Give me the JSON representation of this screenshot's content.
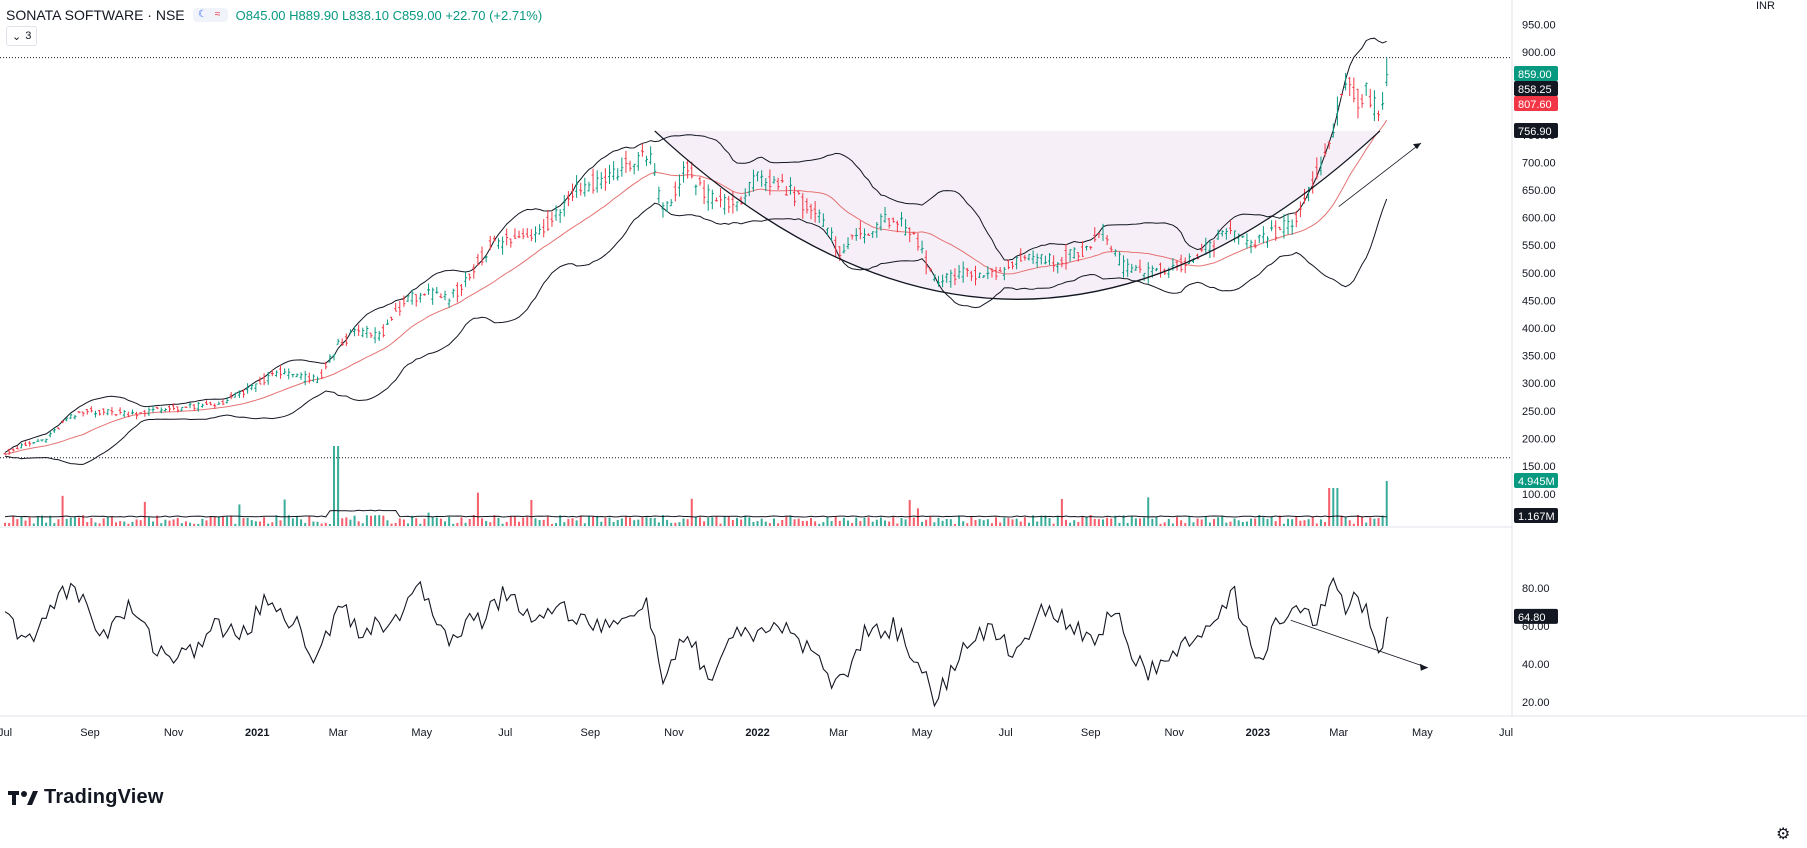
{
  "header": {
    "symbol": "SONATA SOFTWARE · NSE",
    "ohlc": {
      "o": "O845.00",
      "h": "H889.90",
      "l": "L838.10",
      "c": "C859.00",
      "change": "+22.70 (+2.71%)"
    },
    "layers_count": "3"
  },
  "currency": "INR",
  "branding": {
    "logo_text": "TradingView"
  },
  "colors": {
    "up": "#089981",
    "down": "#f23645",
    "ma": "#e57373",
    "band": "#131722",
    "cup_fill": "#f3e8f3"
  },
  "chart_data": [
    {
      "type": "candlestick",
      "title": "SONATA SOFTWARE · NSE",
      "x_ticks": [
        "Jul",
        "Sep",
        "Nov",
        "2021",
        "Mar",
        "May",
        "Jul",
        "Sep",
        "Nov",
        "2022",
        "Mar",
        "May",
        "Jul",
        "Sep",
        "Nov",
        "2023",
        "Mar",
        "May",
        "Jul"
      ],
      "y_ticks": [
        "950.00",
        "900.00",
        "850.00",
        "800.00",
        "750.00",
        "700.00",
        "650.00",
        "600.00",
        "550.00",
        "500.00",
        "450.00",
        "400.00",
        "350.00",
        "300.00",
        "250.00",
        "200.00",
        "150.00"
      ],
      "ylim": [
        130,
        980
      ],
      "price_path": [
        {
          "x": "2020-07-01",
          "y": 175
        },
        {
          "x": "2020-08-01",
          "y": 200
        },
        {
          "x": "2020-08-15",
          "y": 235
        },
        {
          "x": "2020-09-01",
          "y": 250
        },
        {
          "x": "2020-10-01",
          "y": 245
        },
        {
          "x": "2020-11-01",
          "y": 255
        },
        {
          "x": "2020-12-01",
          "y": 260
        },
        {
          "x": "2021-01-01",
          "y": 295
        },
        {
          "x": "2021-01-15",
          "y": 320
        },
        {
          "x": "2021-02-15",
          "y": 305
        },
        {
          "x": "2021-03-01",
          "y": 370
        },
        {
          "x": "2021-03-15",
          "y": 395
        },
        {
          "x": "2021-04-01",
          "y": 385
        },
        {
          "x": "2021-04-15",
          "y": 440
        },
        {
          "x": "2021-05-01",
          "y": 465
        },
        {
          "x": "2021-05-20",
          "y": 450
        },
        {
          "x": "2021-06-01",
          "y": 480
        },
        {
          "x": "2021-06-20",
          "y": 550
        },
        {
          "x": "2021-07-15",
          "y": 565
        },
        {
          "x": "2021-08-01",
          "y": 590
        },
        {
          "x": "2021-08-20",
          "y": 650
        },
        {
          "x": "2021-09-15",
          "y": 675
        },
        {
          "x": "2021-10-01",
          "y": 700
        },
        {
          "x": "2021-10-15",
          "y": 710
        },
        {
          "x": "2021-10-25",
          "y": 605
        },
        {
          "x": "2021-11-10",
          "y": 690
        },
        {
          "x": "2021-11-25",
          "y": 640
        },
        {
          "x": "2021-12-15",
          "y": 620
        },
        {
          "x": "2022-01-01",
          "y": 670
        },
        {
          "x": "2022-01-20",
          "y": 660
        },
        {
          "x": "2022-02-15",
          "y": 600
        },
        {
          "x": "2022-03-01",
          "y": 540
        },
        {
          "x": "2022-03-20",
          "y": 575
        },
        {
          "x": "2022-04-10",
          "y": 600
        },
        {
          "x": "2022-04-25",
          "y": 565
        },
        {
          "x": "2022-05-12",
          "y": 480
        },
        {
          "x": "2022-06-01",
          "y": 500
        },
        {
          "x": "2022-06-25",
          "y": 495
        },
        {
          "x": "2022-07-15",
          "y": 535
        },
        {
          "x": "2022-08-05",
          "y": 520
        },
        {
          "x": "2022-08-25",
          "y": 540
        },
        {
          "x": "2022-09-10",
          "y": 575
        },
        {
          "x": "2022-09-25",
          "y": 510
        },
        {
          "x": "2022-10-15",
          "y": 500
        },
        {
          "x": "2022-11-01",
          "y": 510
        },
        {
          "x": "2022-11-20",
          "y": 530
        },
        {
          "x": "2022-12-10",
          "y": 580
        },
        {
          "x": "2022-12-25",
          "y": 545
        },
        {
          "x": "2023-01-15",
          "y": 575
        },
        {
          "x": "2023-02-01",
          "y": 605
        },
        {
          "x": "2023-02-15",
          "y": 690
        },
        {
          "x": "2023-02-25",
          "y": 760
        },
        {
          "x": "2023-03-05",
          "y": 850
        },
        {
          "x": "2023-03-15",
          "y": 815
        },
        {
          "x": "2023-03-22",
          "y": 835
        },
        {
          "x": "2023-03-31",
          "y": 770
        },
        {
          "x": "2023-04-06",
          "y": 859
        }
      ],
      "price_labels": [
        {
          "value": "859.00",
          "color": "#089981",
          "y": 859
        },
        {
          "value": "858.25",
          "color": "#131722",
          "y": 838
        },
        {
          "value": "807.60",
          "color": "#f23645",
          "y": 815
        },
        {
          "value": "756.90",
          "color": "#131722",
          "y": 757
        }
      ],
      "horizontal_levels": [
        889.9,
        165
      ],
      "bollinger_period_note": ""
    },
    {
      "type": "bar",
      "name": "volume",
      "y_ticks": [
        "100.00"
      ],
      "labels": [
        {
          "value": "4.945M",
          "color": "#089981"
        },
        {
          "value": "1.167M",
          "color": "#131722"
        }
      ]
    },
    {
      "type": "line",
      "name": "oscillator",
      "y_ticks": [
        "80.00",
        "60.00",
        "40.00",
        "20.00"
      ],
      "ylim": [
        14,
        90
      ],
      "last_label": "64.80",
      "path": [
        {
          "x": "2020-07-01",
          "y": 65
        },
        {
          "x": "2020-07-20",
          "y": 50
        },
        {
          "x": "2020-08-10",
          "y": 80
        },
        {
          "x": "2020-08-25",
          "y": 76
        },
        {
          "x": "2020-09-10",
          "y": 55
        },
        {
          "x": "2020-10-01",
          "y": 70
        },
        {
          "x": "2020-10-20",
          "y": 48
        },
        {
          "x": "2020-11-10",
          "y": 43
        },
        {
          "x": "2020-12-01",
          "y": 60
        },
        {
          "x": "2020-12-20",
          "y": 55
        },
        {
          "x": "2021-01-10",
          "y": 75
        },
        {
          "x": "2021-02-01",
          "y": 58
        },
        {
          "x": "2021-02-15",
          "y": 40
        },
        {
          "x": "2021-03-01",
          "y": 75
        },
        {
          "x": "2021-03-20",
          "y": 55
        },
        {
          "x": "2021-04-10",
          "y": 65
        },
        {
          "x": "2021-05-01",
          "y": 78
        },
        {
          "x": "2021-05-20",
          "y": 55
        },
        {
          "x": "2021-06-15",
          "y": 65
        },
        {
          "x": "2021-07-01",
          "y": 78
        },
        {
          "x": "2021-07-20",
          "y": 65
        },
        {
          "x": "2021-08-10",
          "y": 70
        },
        {
          "x": "2021-09-01",
          "y": 62
        },
        {
          "x": "2021-09-20",
          "y": 58
        },
        {
          "x": "2021-10-10",
          "y": 75
        },
        {
          "x": "2021-10-25",
          "y": 30
        },
        {
          "x": "2021-11-10",
          "y": 55
        },
        {
          "x": "2021-11-30",
          "y": 30
        },
        {
          "x": "2021-12-15",
          "y": 60
        },
        {
          "x": "2022-01-01",
          "y": 52
        },
        {
          "x": "2022-01-20",
          "y": 62
        },
        {
          "x": "2022-02-10",
          "y": 45
        },
        {
          "x": "2022-03-01",
          "y": 28
        },
        {
          "x": "2022-03-20",
          "y": 55
        },
        {
          "x": "2022-04-10",
          "y": 60
        },
        {
          "x": "2022-04-25",
          "y": 45
        },
        {
          "x": "2022-05-10",
          "y": 22
        },
        {
          "x": "2022-05-30",
          "y": 45
        },
        {
          "x": "2022-06-20",
          "y": 60
        },
        {
          "x": "2022-07-10",
          "y": 45
        },
        {
          "x": "2022-07-25",
          "y": 70
        },
        {
          "x": "2022-08-15",
          "y": 62
        },
        {
          "x": "2022-09-05",
          "y": 48
        },
        {
          "x": "2022-09-15",
          "y": 72
        },
        {
          "x": "2022-10-05",
          "y": 40
        },
        {
          "x": "2022-10-20",
          "y": 35
        },
        {
          "x": "2022-11-10",
          "y": 50
        },
        {
          "x": "2022-11-30",
          "y": 68
        },
        {
          "x": "2022-12-15",
          "y": 75
        },
        {
          "x": "2022-12-30",
          "y": 40
        },
        {
          "x": "2023-01-15",
          "y": 60
        },
        {
          "x": "2023-02-01",
          "y": 70
        },
        {
          "x": "2023-02-15",
          "y": 63
        },
        {
          "x": "2023-02-25",
          "y": 86
        },
        {
          "x": "2023-03-05",
          "y": 70
        },
        {
          "x": "2023-03-15",
          "y": 75
        },
        {
          "x": "2023-03-25",
          "y": 63
        },
        {
          "x": "2023-04-01",
          "y": 47
        },
        {
          "x": "2023-04-06",
          "y": 64.8
        }
      ]
    }
  ]
}
